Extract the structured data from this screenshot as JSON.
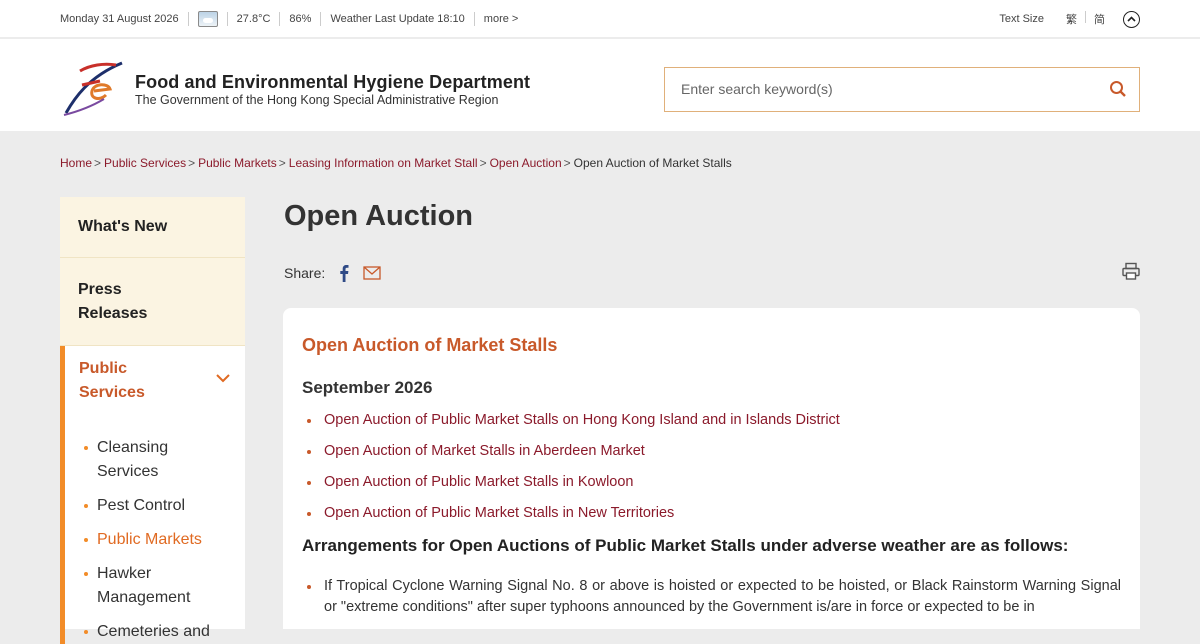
{
  "top_bar": {
    "date": "Monday 31 August 2026",
    "temperature": "27.8°C",
    "humidity": "86%",
    "weather_update": "Weather Last Update 18:10",
    "more": "more >",
    "text_size": "Text Size",
    "lang_trad": "繁",
    "lang_simp": "简"
  },
  "header": {
    "dept_name": "Food and Environmental Hygiene Department",
    "dept_sub": "The Government of the Hong Kong Special Administrative Region",
    "search_placeholder": "Enter search keyword(s)",
    "brand_color": "#c8592a"
  },
  "breadcrumb": [
    {
      "label": "Home",
      "link": true
    },
    {
      "label": "Public Services",
      "link": true
    },
    {
      "label": "Public Markets",
      "link": true
    },
    {
      "label": "Leasing Information on Market Stall",
      "link": true
    },
    {
      "label": "Open Auction",
      "link": true
    },
    {
      "label": "Open Auction of Market Stalls",
      "link": false
    }
  ],
  "sidebar": {
    "whats_new": "What's New",
    "press_releases": "Press Releases",
    "public_services": "Public Services",
    "sub_items": [
      "Cleansing Services",
      "Pest Control",
      "Public Markets",
      "Hawker Management",
      "Cemeteries and"
    ]
  },
  "main": {
    "title": "Open Auction",
    "share_label": "Share:",
    "content_title": "Open Auction of Market Stalls",
    "month": "September 2026",
    "links": [
      "Open Auction of Public Market Stalls on Hong Kong Island and in Islands District",
      "Open Auction of Market Stalls in Aberdeen Market",
      "Open Auction of Public Market Stalls in Kowloon",
      "Open Auction of Public Market Stalls in New Territories"
    ],
    "arrangements_heading": "Arrangements for Open Auctions of Public Market Stalls under adverse weather are as follows:",
    "bullet_1": "If Tropical Cyclone Warning Signal No. 8 or above is hoisted or expected to be hoisted, or Black Rainstorm Warning Signal or \"extreme conditions\" after super typhoons announced by the Government is/are in force or expected to be in"
  }
}
